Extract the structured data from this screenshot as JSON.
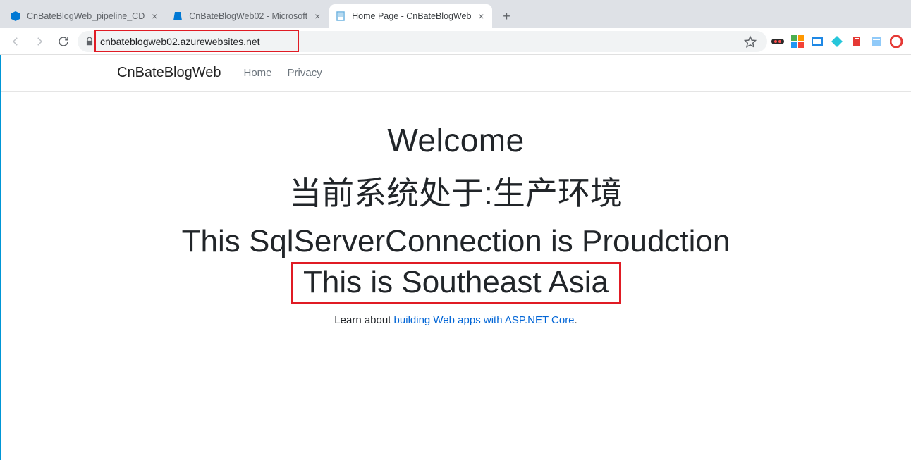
{
  "browser": {
    "tabs": [
      {
        "title": "CnBateBlogWeb_pipeline_CD",
        "active": false,
        "favicon": "devops"
      },
      {
        "title": "CnBateBlogWeb02 - Microsoft",
        "active": false,
        "favicon": "azure"
      },
      {
        "title": "Home Page - CnBateBlogWeb",
        "active": true,
        "favicon": "page"
      }
    ],
    "address": "cnbateblogweb02.azurewebsites.net"
  },
  "site": {
    "brand": "CnBateBlogWeb",
    "nav": [
      {
        "label": "Home"
      },
      {
        "label": "Privacy"
      }
    ]
  },
  "content": {
    "welcome": "Welcome",
    "env_zh": "当前系统处于:生产环境",
    "sql": "This SqlServerConnection is Proudction",
    "region": "This is Southeast Asia",
    "learn_prefix": "Learn about ",
    "learn_link": "building Web apps with ASP.NET Core",
    "learn_suffix": "."
  }
}
